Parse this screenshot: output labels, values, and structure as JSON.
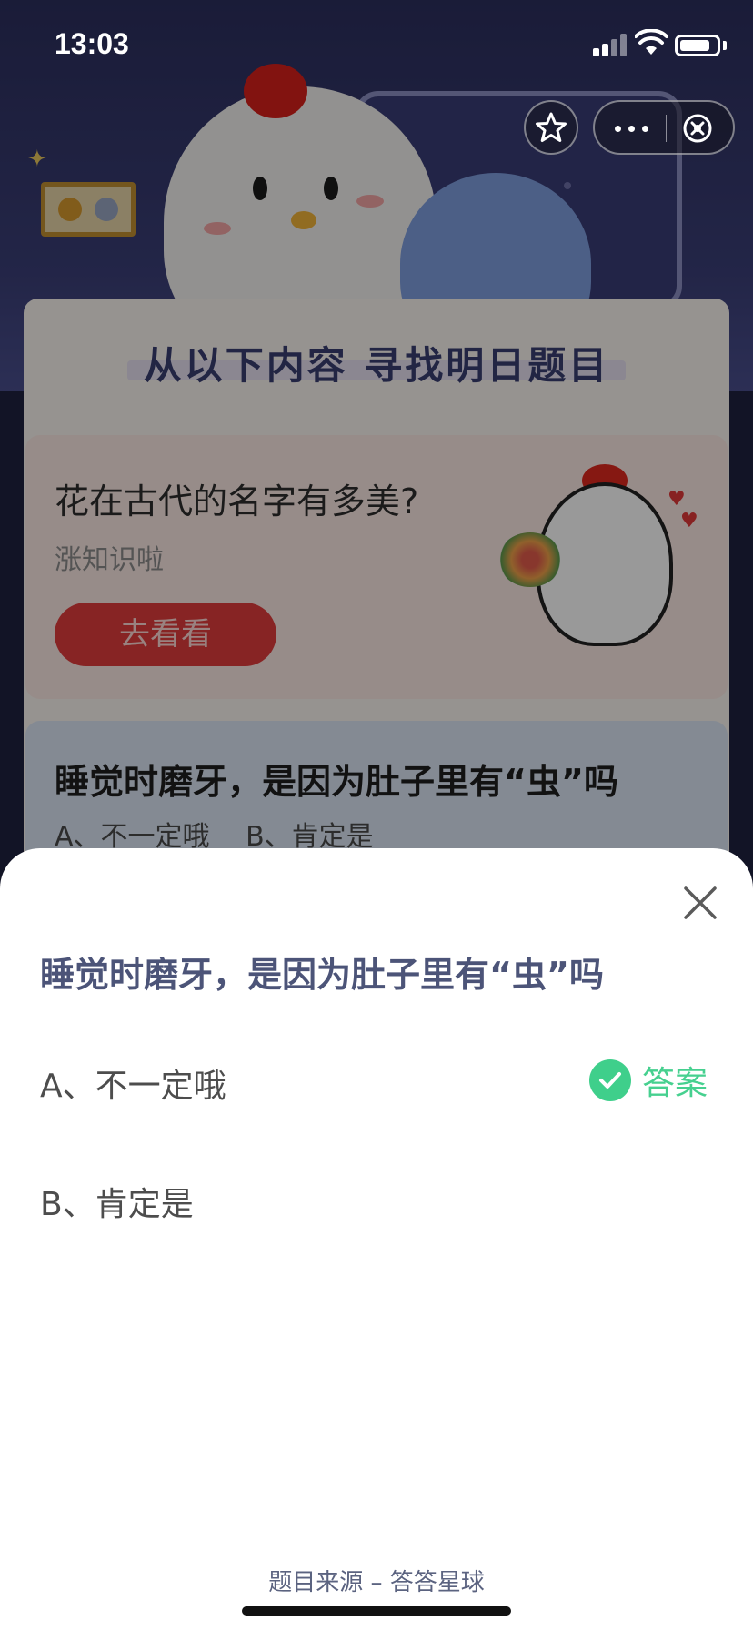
{
  "status_bar": {
    "time": "13:03"
  },
  "background": {
    "banner_title": "从以下内容 寻找明日题目",
    "article_card": {
      "title": "花在古代的名字有多美?",
      "subtitle": "涨知识啦",
      "button": "去看看"
    },
    "question_card": {
      "title": "睡觉时磨牙，是因为肚子里有“虫”吗",
      "option_a": "A、不一定哦",
      "option_b": "B、肯定是"
    }
  },
  "nav": {
    "favorite_icon": "star-icon",
    "more_icon": "more-dots-icon",
    "close_icon": "close-circle-icon"
  },
  "sheet": {
    "question": "睡觉时磨牙，是因为肚子里有“虫”吗",
    "options": [
      {
        "label": "A、不一定哦",
        "is_answer": true
      },
      {
        "label": "B、肯定是",
        "is_answer": false
      }
    ],
    "answer_label": "答案",
    "source": "题目来源 – 答答星球",
    "colors": {
      "answer": "#3fcf8b",
      "question": "#4c5478"
    }
  }
}
